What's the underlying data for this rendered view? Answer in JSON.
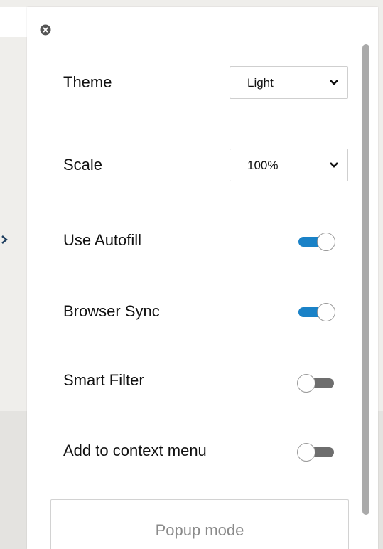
{
  "panel": {
    "close_icon": "close-circle-icon",
    "theme": {
      "label": "Theme",
      "value": "Light"
    },
    "scale": {
      "label": "Scale",
      "value": "100%"
    },
    "toggles": [
      {
        "label": "Use Autofill",
        "on": true
      },
      {
        "label": "Browser Sync",
        "on": true
      },
      {
        "label": "Smart Filter",
        "on": false
      },
      {
        "label": "Add to context menu",
        "on": false
      }
    ],
    "popup_button": "Popup mode"
  },
  "colors": {
    "toggle_on": "#1a82c7",
    "toggle_off": "#6e6e6e",
    "background": "#efeeeb"
  }
}
